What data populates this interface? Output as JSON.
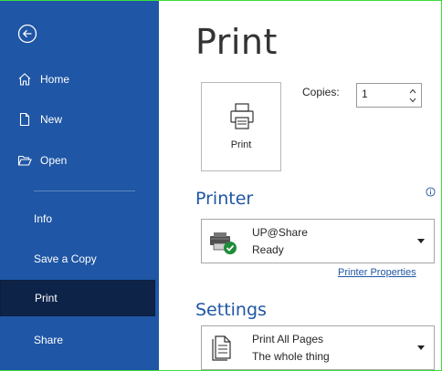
{
  "sidebar": {
    "items": [
      {
        "label": "Home"
      },
      {
        "label": "New"
      },
      {
        "label": "Open"
      },
      {
        "label": "Info"
      },
      {
        "label": "Save a Copy"
      },
      {
        "label": "Print"
      },
      {
        "label": "Share"
      }
    ]
  },
  "main": {
    "title": "Print",
    "print_button_label": "Print",
    "copies": {
      "label": "Copies:",
      "value": "1"
    },
    "printer": {
      "section_title": "Printer",
      "name": "UP@Share",
      "status": "Ready",
      "properties_link": "Printer Properties"
    },
    "settings": {
      "section_title": "Settings",
      "pages_title": "Print All Pages",
      "pages_subtitle": "The whole thing"
    }
  },
  "colors": {
    "sidebar": "#1f56a5",
    "sidebar_active": "#0e2348",
    "accent": "#1f56a5"
  },
  "icons": [
    "back-arrow-icon",
    "home-icon",
    "new-document-icon",
    "folder-open-icon",
    "printer-icon",
    "info-icon",
    "printer-ready-icon",
    "document-pages-icon"
  ]
}
